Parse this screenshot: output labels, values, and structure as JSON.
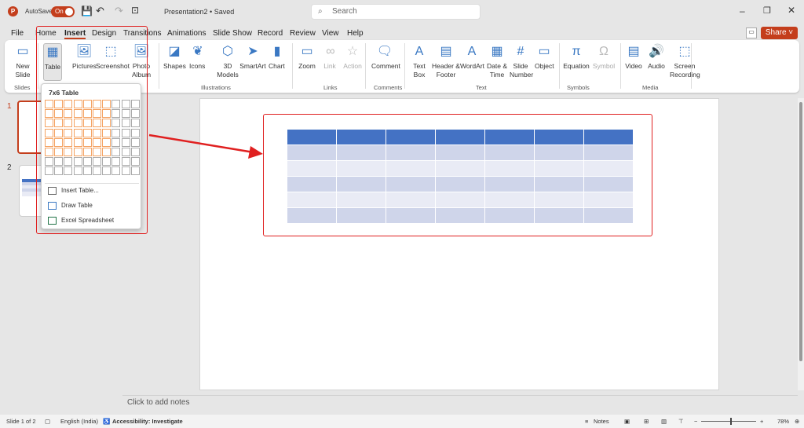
{
  "titlebar": {
    "app_letter": "P",
    "autosave_label": "AutoSave",
    "autosave_state": "On",
    "doc_title": "Presentation2 • Saved",
    "search_placeholder": "Search"
  },
  "tabs": [
    "File",
    "Home",
    "Insert",
    "Design",
    "Transitions",
    "Animations",
    "Slide Show",
    "Record",
    "Review",
    "View",
    "Help"
  ],
  "share_label": "Share",
  "ribbon": {
    "buttons": [
      {
        "label": "New Slide",
        "icon": "new-slide-icon"
      },
      {
        "label": "Table",
        "icon": "table-icon"
      },
      {
        "label": "Pictures",
        "icon": "pictures-icon"
      },
      {
        "label": "Screenshot",
        "icon": "screenshot-icon"
      },
      {
        "label": "Photo Album",
        "icon": "photo-album-icon"
      },
      {
        "label": "Shapes",
        "icon": "shapes-icon"
      },
      {
        "label": "Icons",
        "icon": "icons-icon"
      },
      {
        "label": "3D Models",
        "icon": "3d-models-icon"
      },
      {
        "label": "SmartArt",
        "icon": "smartart-icon"
      },
      {
        "label": "Chart",
        "icon": "chart-icon"
      },
      {
        "label": "Zoom",
        "icon": "zoom-icon"
      },
      {
        "label": "Link",
        "icon": "link-icon"
      },
      {
        "label": "Action",
        "icon": "action-icon"
      },
      {
        "label": "Comment",
        "icon": "comment-icon"
      },
      {
        "label": "Text Box",
        "icon": "text-box-icon"
      },
      {
        "label": "Header & Footer",
        "icon": "header-footer-icon"
      },
      {
        "label": "WordArt",
        "icon": "wordart-icon"
      },
      {
        "label": "Date & Time",
        "icon": "date-time-icon"
      },
      {
        "label": "Slide Number",
        "icon": "slide-number-icon"
      },
      {
        "label": "Object",
        "icon": "object-icon"
      },
      {
        "label": "Equation",
        "icon": "equation-icon"
      },
      {
        "label": "Symbol",
        "icon": "symbol-icon"
      },
      {
        "label": "Video",
        "icon": "video-icon"
      },
      {
        "label": "Audio",
        "icon": "audio-icon"
      },
      {
        "label": "Screen Recording",
        "icon": "screen-recording-icon"
      }
    ],
    "groups": [
      "Slides",
      "Illustrations",
      "Links",
      "Comments",
      "Text",
      "Symbols",
      "Media"
    ]
  },
  "table_dropdown": {
    "title": "7x6 Table",
    "cols": 10,
    "rows": 8,
    "selected_cols": 7,
    "selected_rows": 6,
    "items": [
      "Insert Table...",
      "Draw Table",
      "Excel Spreadsheet"
    ]
  },
  "thumbnails": [
    "1",
    "2"
  ],
  "slide_table": {
    "cols": 7,
    "rows": 6,
    "header_color": "#4472c4",
    "band1": "#cfd5ea",
    "band2": "#e9ebf5"
  },
  "notes_placeholder": "Click to add notes",
  "status": {
    "slide": "Slide 1 of 2",
    "language": "English (India)",
    "accessibility": "Accessibility: Investigate",
    "notes": "Notes",
    "zoom": "78%"
  }
}
